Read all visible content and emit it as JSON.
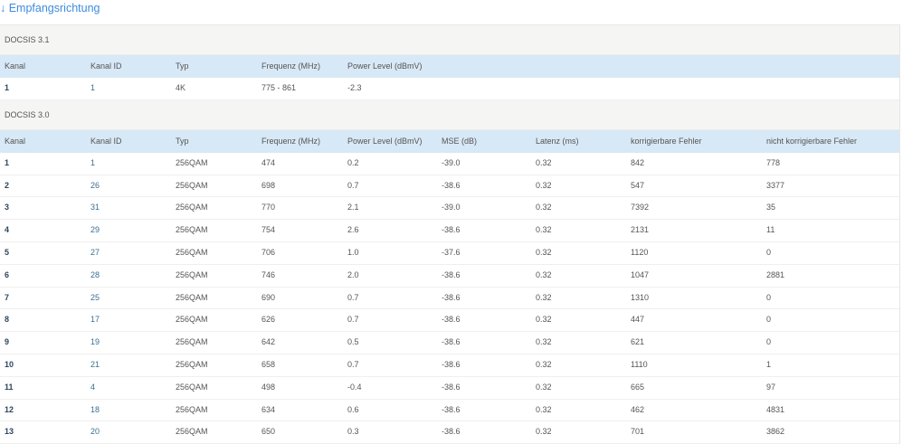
{
  "title": "↓ Empfangsrichtung",
  "docsis31": {
    "label": "DOCSIS 3.1",
    "headers": [
      "Kanal",
      "Kanal ID",
      "Typ",
      "Frequenz (MHz)",
      "Power Level (dBmV)"
    ],
    "rows": [
      [
        "1",
        "1",
        "4K",
        "775 - 861",
        "-2.3"
      ]
    ]
  },
  "docsis30": {
    "label": "DOCSIS 3.0",
    "headers": [
      "Kanal",
      "Kanal ID",
      "Typ",
      "Frequenz (MHz)",
      "Power Level (dBmV)",
      "MSE (dB)",
      "Latenz (ms)",
      "korrigierbare Fehler",
      "nicht korrigierbare Fehler"
    ],
    "rows": [
      [
        "1",
        "1",
        "256QAM",
        "474",
        "0.2",
        "-39.0",
        "0.32",
        "842",
        "778"
      ],
      [
        "2",
        "26",
        "256QAM",
        "698",
        "0.7",
        "-38.6",
        "0.32",
        "547",
        "3377"
      ],
      [
        "3",
        "31",
        "256QAM",
        "770",
        "2.1",
        "-39.0",
        "0.32",
        "7392",
        "35"
      ],
      [
        "4",
        "29",
        "256QAM",
        "754",
        "2.6",
        "-38.6",
        "0.32",
        "2131",
        "11"
      ],
      [
        "5",
        "27",
        "256QAM",
        "706",
        "1.0",
        "-37.6",
        "0.32",
        "1120",
        "0"
      ],
      [
        "6",
        "28",
        "256QAM",
        "746",
        "2.0",
        "-38.6",
        "0.32",
        "1047",
        "2881"
      ],
      [
        "7",
        "25",
        "256QAM",
        "690",
        "0.7",
        "-38.6",
        "0.32",
        "1310",
        "0"
      ],
      [
        "8",
        "17",
        "256QAM",
        "626",
        "0.7",
        "-38.6",
        "0.32",
        "447",
        "0"
      ],
      [
        "9",
        "19",
        "256QAM",
        "642",
        "0.5",
        "-38.6",
        "0.32",
        "621",
        "0"
      ],
      [
        "10",
        "21",
        "256QAM",
        "658",
        "0.7",
        "-38.6",
        "0.32",
        "1110",
        "1"
      ],
      [
        "11",
        "4",
        "256QAM",
        "498",
        "-0.4",
        "-38.6",
        "0.32",
        "665",
        "97"
      ],
      [
        "12",
        "18",
        "256QAM",
        "634",
        "0.6",
        "-38.6",
        "0.32",
        "462",
        "4831"
      ],
      [
        "13",
        "20",
        "256QAM",
        "650",
        "0.3",
        "-38.6",
        "0.32",
        "701",
        "3862"
      ]
    ]
  }
}
